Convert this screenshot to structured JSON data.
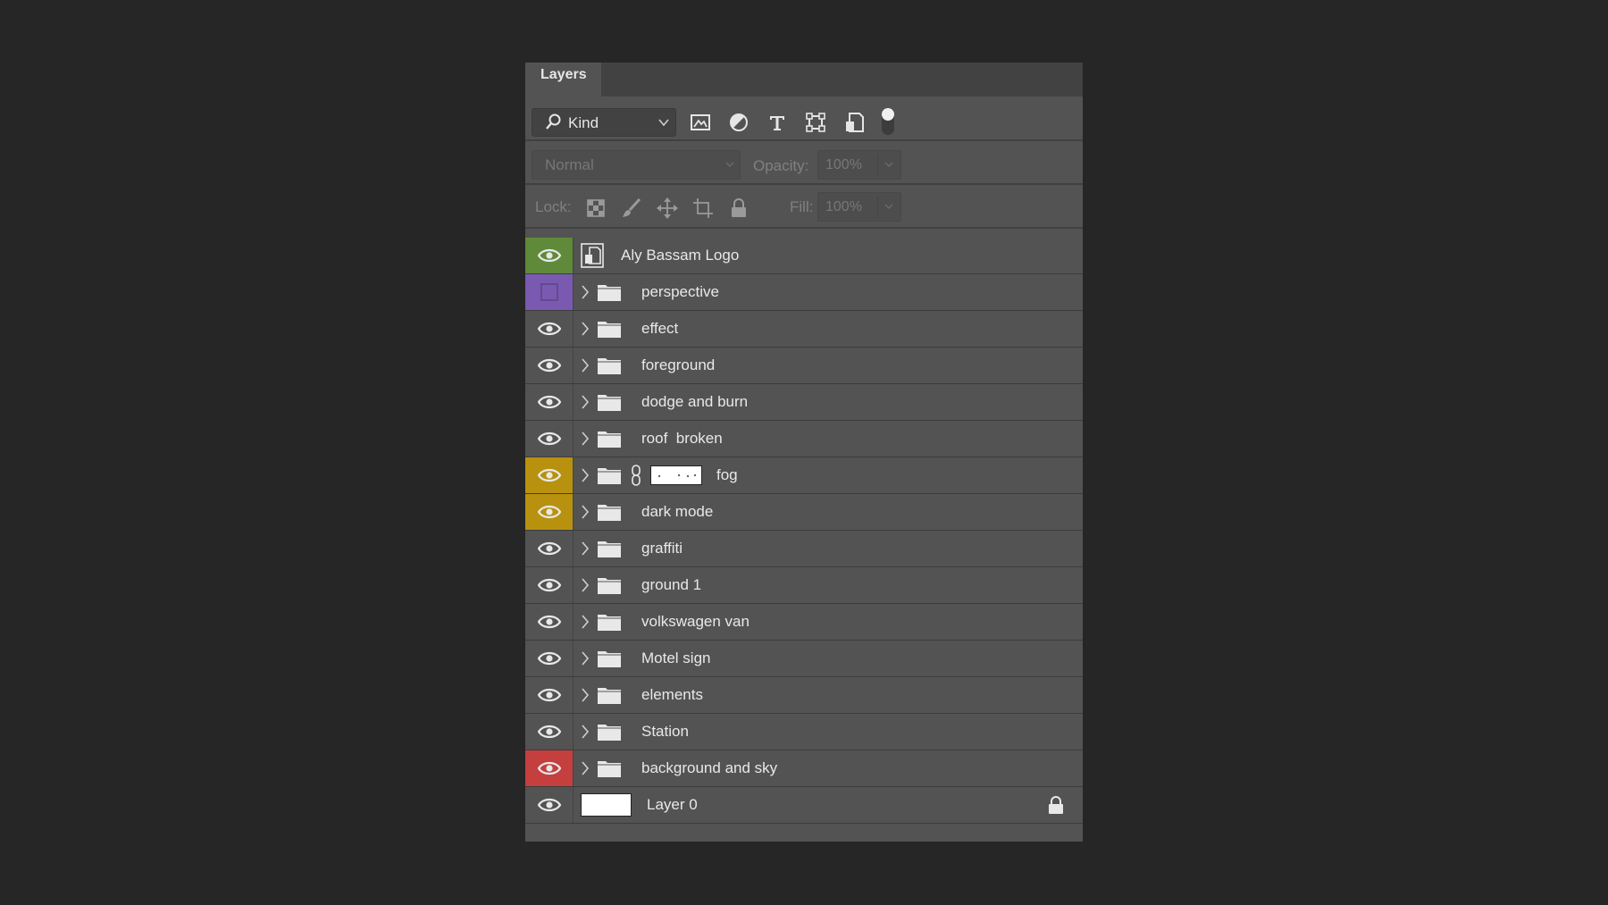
{
  "panel": {
    "tab": "Layers"
  },
  "filter": {
    "kind_label": "Kind",
    "icons": [
      "pixel-filter-icon",
      "adjustment-filter-icon",
      "type-filter-icon",
      "shape-filter-icon",
      "smart-object-filter-icon",
      "filter-toggle-icon"
    ]
  },
  "blend": {
    "mode": "Normal",
    "opacity_label": "Opacity:",
    "opacity_value": "100%"
  },
  "lock": {
    "label": "Lock:",
    "fill_label": "Fill:",
    "fill_value": "100%"
  },
  "colors": {
    "green": "#5f8a3a",
    "violet": "#7a5ab0",
    "yellow": "#b8920e",
    "red": "#c53f3f"
  },
  "layers": [
    {
      "name": "Aly Bassam Logo",
      "type": "smart-object",
      "visible": true,
      "color": "green"
    },
    {
      "name": "perspective",
      "type": "group",
      "visible": false,
      "color": "violet"
    },
    {
      "name": "effect",
      "type": "group",
      "visible": true,
      "color": ""
    },
    {
      "name": "foreground",
      "type": "group",
      "visible": true,
      "color": ""
    },
    {
      "name": "dodge and burn",
      "type": "group",
      "visible": true,
      "color": ""
    },
    {
      "name": "roof  broken",
      "type": "group",
      "visible": true,
      "color": ""
    },
    {
      "name": "fog",
      "type": "group-with-mask",
      "visible": true,
      "color": "yellow"
    },
    {
      "name": "dark mode",
      "type": "group",
      "visible": true,
      "color": "yellow"
    },
    {
      "name": "graffiti",
      "type": "group",
      "visible": true,
      "color": ""
    },
    {
      "name": "ground 1",
      "type": "group",
      "visible": true,
      "color": ""
    },
    {
      "name": "volkswagen van",
      "type": "group",
      "visible": true,
      "color": ""
    },
    {
      "name": "Motel sign",
      "type": "group",
      "visible": true,
      "color": ""
    },
    {
      "name": "elements",
      "type": "group",
      "visible": true,
      "color": ""
    },
    {
      "name": "Station",
      "type": "group",
      "visible": true,
      "color": ""
    },
    {
      "name": "background and sky",
      "type": "group",
      "visible": true,
      "color": "red"
    },
    {
      "name": "Layer 0",
      "type": "pixel-locked",
      "visible": true,
      "color": ""
    }
  ]
}
